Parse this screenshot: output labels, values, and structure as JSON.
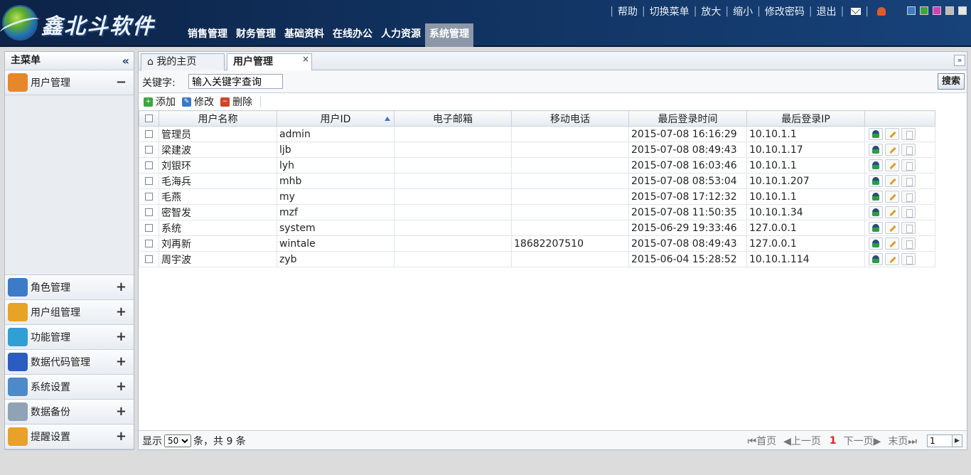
{
  "app": {
    "logo_text": "鑫北斗软件",
    "nav": [
      "销售管理",
      "财务管理",
      "基础资料",
      "在线办公",
      "人力资源",
      "系统管理"
    ],
    "active_nav": "系统管理",
    "top_links": [
      "帮助",
      "切换菜单",
      "放大",
      "缩小",
      "修改密码",
      "退出"
    ],
    "theme_colors": [
      "#3b7dc4",
      "#3aa83a",
      "#d43fb5",
      "#bcbcbc",
      "#e6e6e6"
    ]
  },
  "sidebar": {
    "title": "主菜单",
    "collapse_glyph": "«",
    "active_item": {
      "label": "用户管理",
      "toggle": "−",
      "icon": "users-icon",
      "color": "#e8862a"
    },
    "items": [
      {
        "label": "角色管理",
        "toggle": "+",
        "icon": "lock-icon",
        "color": "#3c7bc8"
      },
      {
        "label": "用户组管理",
        "toggle": "+",
        "icon": "group-icon",
        "color": "#e6a326"
      },
      {
        "label": "功能管理",
        "toggle": "+",
        "icon": "snowflake-icon",
        "color": "#2f9fd6"
      },
      {
        "label": "数据代码管理",
        "toggle": "+",
        "icon": "cube-icon",
        "color": "#2a5dbf"
      },
      {
        "label": "系统设置",
        "toggle": "+",
        "icon": "wrench-icon",
        "color": "#4c8ac9"
      },
      {
        "label": "数据备份",
        "toggle": "+",
        "icon": "database-icon",
        "color": "#8fa3b5"
      },
      {
        "label": "提醒设置",
        "toggle": "+",
        "icon": "alarm-clock-icon",
        "color": "#e8a12a"
      }
    ]
  },
  "tabs": [
    {
      "label": "我的主页",
      "icon": "home-icon"
    },
    {
      "label": "用户管理",
      "close": "×"
    }
  ],
  "search": {
    "label": "关键字:",
    "placeholder": "输入关键字查询",
    "button": "搜索"
  },
  "toolbar": {
    "add": "添加",
    "edit": "修改",
    "delete": "删除"
  },
  "table": {
    "columns": [
      "用户名称",
      "用户ID",
      "电子邮箱",
      "移动电话",
      "最后登录时间",
      "最后登录IP"
    ],
    "sorted_column": "用户ID",
    "rows": [
      [
        "管理员",
        "admin",
        "",
        "",
        "2015-07-08 16:16:29",
        "10.10.1.1"
      ],
      [
        "梁建波",
        "ljb",
        "",
        "",
        "2015-07-08 08:49:43",
        "10.10.1.17"
      ],
      [
        "刘银环",
        "lyh",
        "",
        "",
        "2015-07-08 16:03:46",
        "10.10.1.1"
      ],
      [
        "毛海兵",
        "mhb",
        "",
        "",
        "2015-07-08 08:53:04",
        "10.10.1.207"
      ],
      [
        "毛燕",
        "my",
        "",
        "",
        "2015-07-08 17:12:32",
        "10.10.1.1"
      ],
      [
        "密智发",
        "mzf",
        "",
        "",
        "2015-07-08 11:50:35",
        "10.10.1.34"
      ],
      [
        "系统",
        "system",
        "",
        "",
        "2015-06-29 19:33:46",
        "127.0.0.1"
      ],
      [
        "刘再新",
        "wintale",
        "",
        "18682207510",
        "2015-07-08 08:49:43",
        "127.0.0.1"
      ],
      [
        "周宇波",
        "zyb",
        "",
        "",
        "2015-06-04 15:28:52",
        "10.10.1.114"
      ]
    ]
  },
  "footer": {
    "show_label": "显示",
    "page_size": "50",
    "summary": "条，共 9 条",
    "first": "首页",
    "prev": "上一页",
    "current": "1",
    "next": "下一页",
    "last": "末页",
    "goto_value": "1"
  }
}
